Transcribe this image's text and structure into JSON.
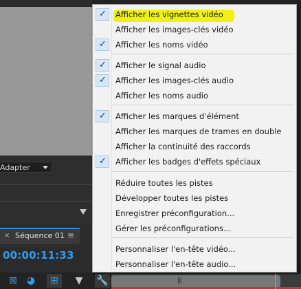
{
  "monitor": {
    "fit_dropdown_value": "Adapter"
  },
  "sequence_panel": {
    "tab_close": "×",
    "tab_title": "Séquence 01",
    "tab_menu": "≡",
    "timecode": "00:00:11:33"
  },
  "toolbar": {
    "icons": [
      "snap-icon",
      "link-icon",
      "add-marker-icon",
      "marker-icon",
      "wrench-icon"
    ]
  },
  "context_menu": {
    "items": [
      {
        "label": "Afficher les vignettes vidéo",
        "checked": true,
        "highlighted": true
      },
      {
        "label": "Afficher les images-clés vidéo",
        "checked": false
      },
      {
        "label": "Afficher les noms vidéo",
        "checked": true
      },
      {
        "label": "Afficher le signal audio",
        "checked": true
      },
      {
        "label": "Afficher les images-clés audio",
        "checked": true
      },
      {
        "label": "Afficher les noms audio",
        "checked": false
      },
      {
        "label": "Afficher les marques d'élément",
        "checked": true
      },
      {
        "label": "Afficher les marques de trames en double",
        "checked": false
      },
      {
        "label": "Afficher la continuité des raccords",
        "checked": false
      },
      {
        "label": "Afficher les badges d'effets spéciaux",
        "checked": true
      },
      {
        "label": "Réduire toutes les pistes",
        "checked": false
      },
      {
        "label": "Développer toutes les pistes",
        "checked": false
      },
      {
        "label": "Enregistrer préconfiguration...",
        "checked": false
      },
      {
        "label": "Gérer les préconfigurations...",
        "checked": false
      },
      {
        "label": "Personnaliser l'en-tête vidéo...",
        "checked": false
      },
      {
        "label": "Personnaliser l'en-tête audio...",
        "checked": false
      }
    ],
    "check_glyph": "✓"
  },
  "colors": {
    "accent_blue": "#2f9cf4",
    "highlight_yellow": "#f0f012",
    "menu_bg": "#f2f2f2",
    "playhead_red": "#d62d2d"
  }
}
